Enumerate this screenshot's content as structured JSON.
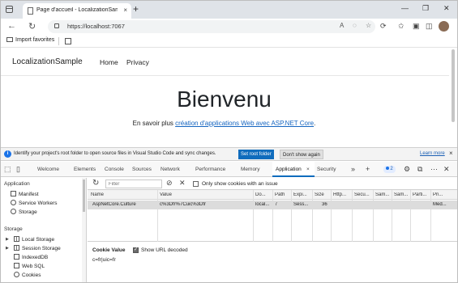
{
  "browser": {
    "tab_title": "Page d'accueil - LocalizationSample",
    "tab_close": "×",
    "new_tab": "+",
    "window_controls": [
      "—",
      "❐",
      "✕"
    ],
    "url": "https://localhost:7067",
    "read_aloud": "A",
    "favorites_bar": {
      "import_label": "Import favorites"
    }
  },
  "site": {
    "brand": "LocalizationSample",
    "nav": [
      "Home",
      "Privacy"
    ],
    "heading": "Bienvenu",
    "lead_prefix": "En savoir plus ",
    "lead_link": "création d'applications Web avec ASP.NET Core",
    "lead_suffix": "."
  },
  "devtools": {
    "infobar": {
      "icon": "i",
      "text": "Identify your project's root folder to open source files in Visual Studio Code and sync changes.",
      "primary_button": "Set root folder",
      "secondary_button": "Don't show again",
      "learn_more": "Learn more",
      "close": "×"
    },
    "tabs": [
      "Welcome",
      "Elements",
      "Console",
      "Sources",
      "Network",
      "Performance",
      "Memory",
      "Application",
      "Security"
    ],
    "active_tab": "Application",
    "active_tab_close": "×",
    "more_tabs": "»",
    "add_tab": "+",
    "issues_count": "2",
    "sidebar": {
      "application_header": "Application",
      "application_items": [
        "Manifest",
        "Service Workers",
        "Storage"
      ],
      "storage_header": "Storage",
      "storage_items": [
        "Local Storage",
        "Session Storage",
        "IndexedDB",
        "Web SQL",
        "Cookies"
      ]
    },
    "cookies": {
      "filter_placeholder": "Filter",
      "only_issue_label": "Only show cookies with an issue",
      "columns": [
        "Name",
        "Value",
        "Do...",
        "Path",
        "Expi...",
        "Size",
        "Http...",
        "Secu...",
        "Sam...",
        "Sam...",
        "Parti...",
        "Pri..."
      ],
      "rows": [
        [
          "AspNetCore.Culture",
          "c%3Dfr%7Cuic%3Dfr",
          "local...",
          "/",
          "Sess...",
          "36",
          "",
          "",
          "",
          "",
          "",
          "Med..."
        ]
      ],
      "value_pane": {
        "title": "Cookie Value",
        "decode_label": "Show URL decoded",
        "value": "c=fr|uic=fr"
      }
    }
  },
  "colors": {
    "accent": "#0f6cbd",
    "link": "#1565c0",
    "selected_row": "#dcdcdc"
  }
}
